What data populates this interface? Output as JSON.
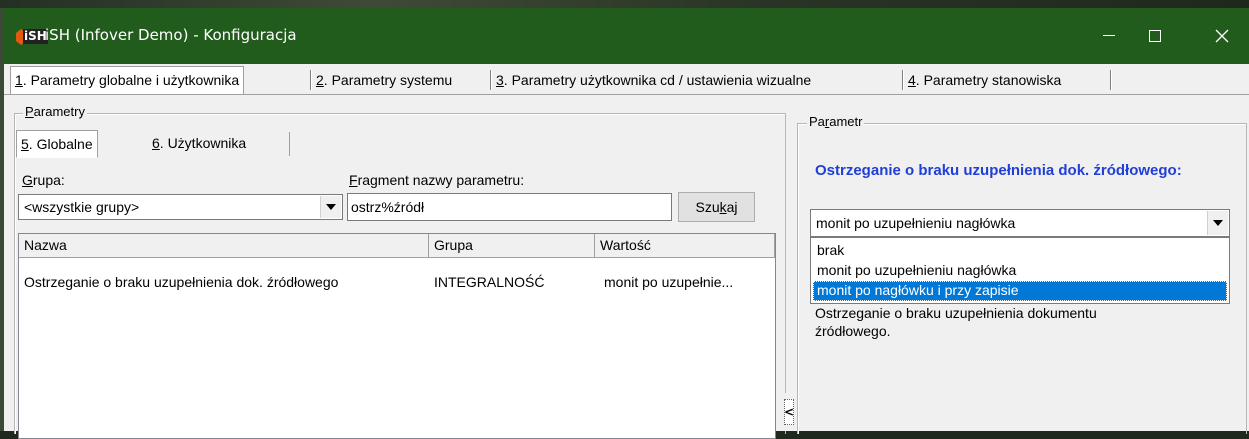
{
  "window": {
    "title": "iSH (Infover Demo) - Konfiguracja",
    "app_icon_label": "iSH",
    "titlebar_color": "#225c1d"
  },
  "main_tabs": [
    {
      "num": "1",
      "label": ". Parametry globalne i użytkownika",
      "active": true
    },
    {
      "num": "2",
      "label": ". Parametry systemu",
      "active": false
    },
    {
      "num": "3",
      "label": ". Parametry użytkownika cd / ustawienia wizualne",
      "active": false
    },
    {
      "num": "4",
      "label": ". Parametry stanowiska",
      "active": false
    }
  ],
  "parametry": {
    "legend_u": "P",
    "legend_rest": "arametry",
    "subtabs": [
      {
        "num": "5",
        "label": ". Globalne",
        "active": true
      },
      {
        "num": "6",
        "label": ". Użytkownika",
        "active": false
      }
    ],
    "group_label_u": "G",
    "group_label_rest": "rupa:",
    "group_value": "<wszystkie grupy>",
    "fragment_label_u": "F",
    "fragment_label_rest": "ragment nazwy parametru:",
    "fragment_value": "ostrz%źródł",
    "search_button_pre": "Szu",
    "search_button_u": "k",
    "search_button_post": "aj",
    "columns": [
      "Nazwa",
      "Grupa",
      "Wartość"
    ],
    "rows": [
      {
        "nazwa": "Ostrzeganie o braku uzupełnienia dok. źródłowego",
        "grupa": "INTEGRALNOŚĆ",
        "wartosc": "monit po uzupełnie..."
      }
    ]
  },
  "parametr": {
    "legend_pre": "Pa",
    "legend_u": "r",
    "legend_post": "ametr",
    "title": "Ostrzeganie o braku uzupełnienia dok. źródłowego:",
    "selected_value": "monit po uzupełnieniu nagłówka",
    "options": [
      "brak",
      "monit po uzupełnieniu nagłówka",
      "monit po nagłówku i przy zapisie"
    ],
    "highlighted_option_index": 2,
    "description": "Ostrzeganie o braku uzupełnienia dokumentu źródłowego."
  },
  "colors": {
    "accent_blue": "#1f3fd6",
    "selection": "#0078d7"
  }
}
